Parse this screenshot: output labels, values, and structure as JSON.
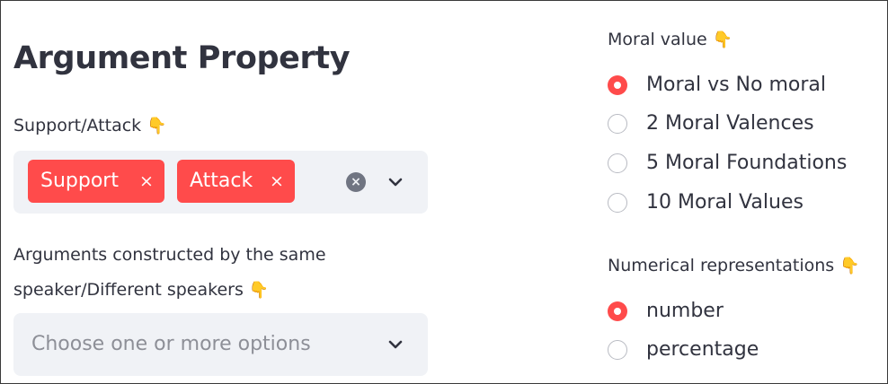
{
  "title": "Argument Property",
  "emoji": "👇",
  "support_attack": {
    "label": "Support/Attack",
    "tags": [
      {
        "label": "Support",
        "remove": "×"
      },
      {
        "label": "Attack",
        "remove": "×"
      }
    ],
    "clear_symbol": "×"
  },
  "speakers": {
    "label_line1": "Arguments constructed by the same",
    "label_line2": "speaker/Different speakers",
    "placeholder": "Choose one or more options"
  },
  "moral_value": {
    "label": "Moral value",
    "options": [
      {
        "label": "Moral vs No moral",
        "checked": true
      },
      {
        "label": "2 Moral Valences",
        "checked": false
      },
      {
        "label": "5 Moral Foundations",
        "checked": false
      },
      {
        "label": "10 Moral Values",
        "checked": false
      }
    ]
  },
  "numerical": {
    "label": "Numerical representations",
    "options": [
      {
        "label": "number",
        "checked": true
      },
      {
        "label": "percentage",
        "checked": false
      }
    ]
  },
  "colors": {
    "accent": "#ff4b4b",
    "field_bg": "#f0f2f6",
    "text": "#31333f",
    "placeholder": "#8d8f97"
  }
}
